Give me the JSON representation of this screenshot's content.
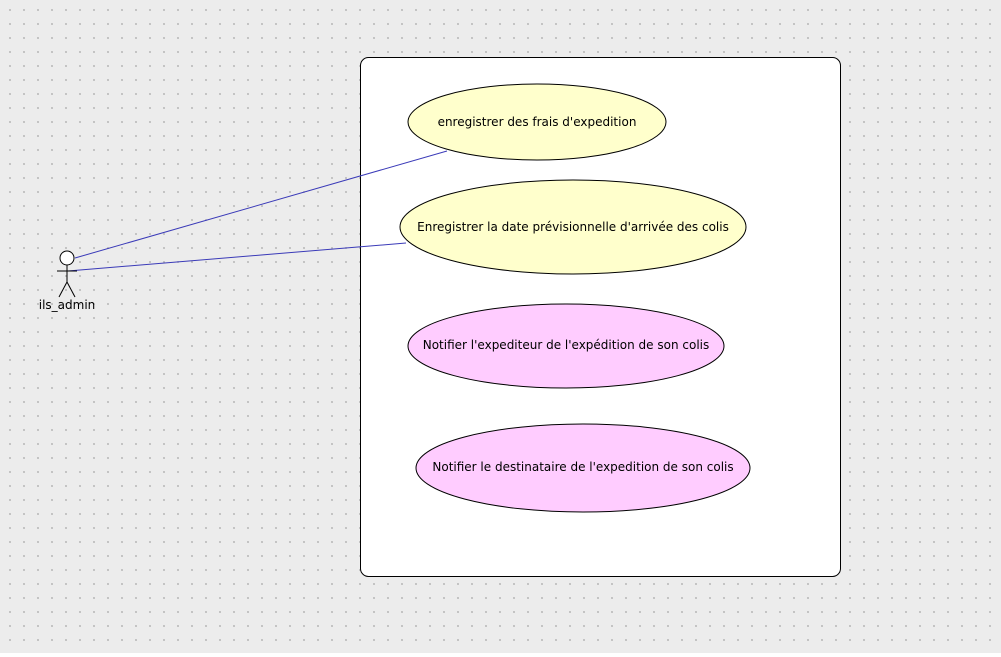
{
  "actor": {
    "name": "ils_admin"
  },
  "use_cases": [
    {
      "label": "enregistrer des frais d'expedition",
      "fill": "#ffffcc"
    },
    {
      "label": "Enregistrer la date prévisionnelle d'arrivée des colis",
      "fill": "#ffffcc"
    },
    {
      "label": "Notifier l'expediteur de l'expédition de son colis",
      "fill": "#ffccff"
    },
    {
      "label": "Notifier le destinataire de l'expedition de son colis",
      "fill": "#ffccff"
    }
  ],
  "colors": {
    "association_line": "#3a3ab8",
    "outline": "#000000",
    "system_box_fill": "#ffffff"
  }
}
